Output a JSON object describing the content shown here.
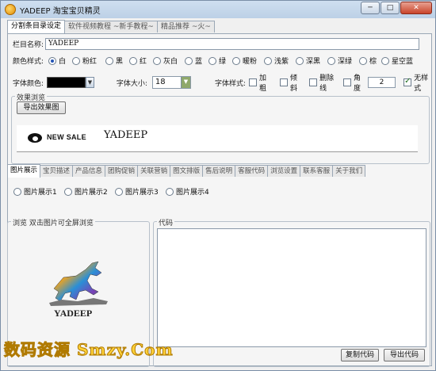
{
  "window": {
    "title": "YADEEP 淘宝宝贝精灵",
    "buttons": {
      "minimize": "─",
      "maximize": "□",
      "close": "✕"
    }
  },
  "top_tabs": [
    {
      "label": "分割条目录设定",
      "active": true
    },
    {
      "label": "软件视频教程 ~新手教程~",
      "active": false
    },
    {
      "label": "精品推荐 ~火~",
      "active": false
    }
  ],
  "form": {
    "column_name_label": "栏目名称:",
    "column_name_value": "YADEEP",
    "color_style_label": "颜色样式:",
    "color_options": [
      {
        "label": "白",
        "selected": true
      },
      {
        "label": "粉红",
        "selected": false
      },
      {
        "label": "黑",
        "selected": false
      },
      {
        "label": "红",
        "selected": false
      },
      {
        "label": "灰白",
        "selected": false
      },
      {
        "label": "蓝",
        "selected": false
      },
      {
        "label": "绿",
        "selected": false
      },
      {
        "label": "暖粉",
        "selected": false
      },
      {
        "label": "浅紫",
        "selected": false
      },
      {
        "label": "深黑",
        "selected": false
      },
      {
        "label": "深绿",
        "selected": false
      },
      {
        "label": "棕",
        "selected": false
      },
      {
        "label": "星空蓝",
        "selected": false
      }
    ],
    "font_color_label": "字体颜色:",
    "font_color_value": "#000000",
    "font_size_label": "字体大小:",
    "font_size_value": "18",
    "font_style_label": "字体样式:",
    "style_options": [
      {
        "label": "加粗",
        "checked": false
      },
      {
        "label": "倾斜",
        "checked": false
      },
      {
        "label": "删除线",
        "checked": false
      },
      {
        "label": "角度",
        "checked": false
      }
    ],
    "angle_value": "2",
    "no_style": {
      "label": "无样式",
      "checked": true
    }
  },
  "preview": {
    "group_title": "效果浏览",
    "export_button": "导出效果图",
    "sale_text": "NEW SALE",
    "brand_text": "YADEEP"
  },
  "mid_tabs": [
    {
      "label": "图片展示",
      "active": true
    },
    {
      "label": "宝贝描述",
      "active": false
    },
    {
      "label": "产品信息",
      "active": false
    },
    {
      "label": "团购促销",
      "active": false
    },
    {
      "label": "关联营销",
      "active": false
    },
    {
      "label": "图文排版",
      "active": false
    },
    {
      "label": "售后说明",
      "active": false
    },
    {
      "label": "客服代码",
      "active": false
    },
    {
      "label": "浏览设置",
      "active": false
    },
    {
      "label": "联系客服",
      "active": false
    },
    {
      "label": "关于我们",
      "active": false
    }
  ],
  "display_options": [
    {
      "label": "图片展示1",
      "selected": false
    },
    {
      "label": "图片展示2",
      "selected": false
    },
    {
      "label": "图片展示3",
      "selected": false
    },
    {
      "label": "图片展示4",
      "selected": false
    }
  ],
  "browse": {
    "title": "浏览   双击图片可全屏浏览",
    "logo_text": "YADEEP"
  },
  "code": {
    "title": "代码",
    "copy_button": "复制代码",
    "export_button": "导出代码"
  },
  "watermark": "数码资源 Smzy.Com"
}
